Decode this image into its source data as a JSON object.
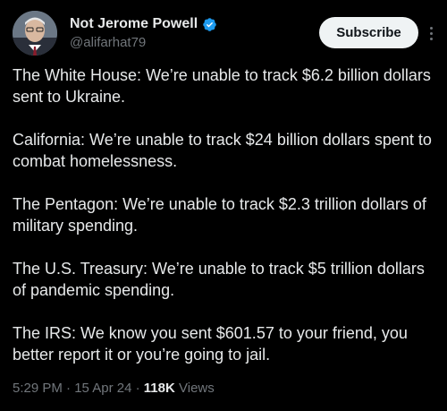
{
  "author": {
    "display_name": "Not Jerome Powell",
    "handle": "@alifarhat79",
    "verified_color": "#1d9bf0"
  },
  "actions": {
    "subscribe_label": "Subscribe",
    "more_icon": "more-vertical-icon"
  },
  "tweet": {
    "paragraphs": [
      "The White House: We’re unable to track $6.2 billion dollars sent to Ukraine.",
      "California: We’re unable to track $24 billion dollars spent to combat homelessness.",
      "The Pentagon: We’re unable to track $2.3 trillion dollars of military spending.",
      "The U.S. Treasury: We’re unable to track $5 trillion dollars of pandemic spending.",
      "The IRS: We know you sent $601.57 to your friend, you better report it or you’re going to jail."
    ]
  },
  "meta": {
    "time": "5:29 PM",
    "date": "15 Apr 24",
    "separator": "·",
    "views_count": "118K",
    "views_label": "Views"
  },
  "colors": {
    "background": "#000000",
    "text": "#e7e9ea",
    "secondary": "#71767b",
    "button_bg": "#eff3f4"
  }
}
